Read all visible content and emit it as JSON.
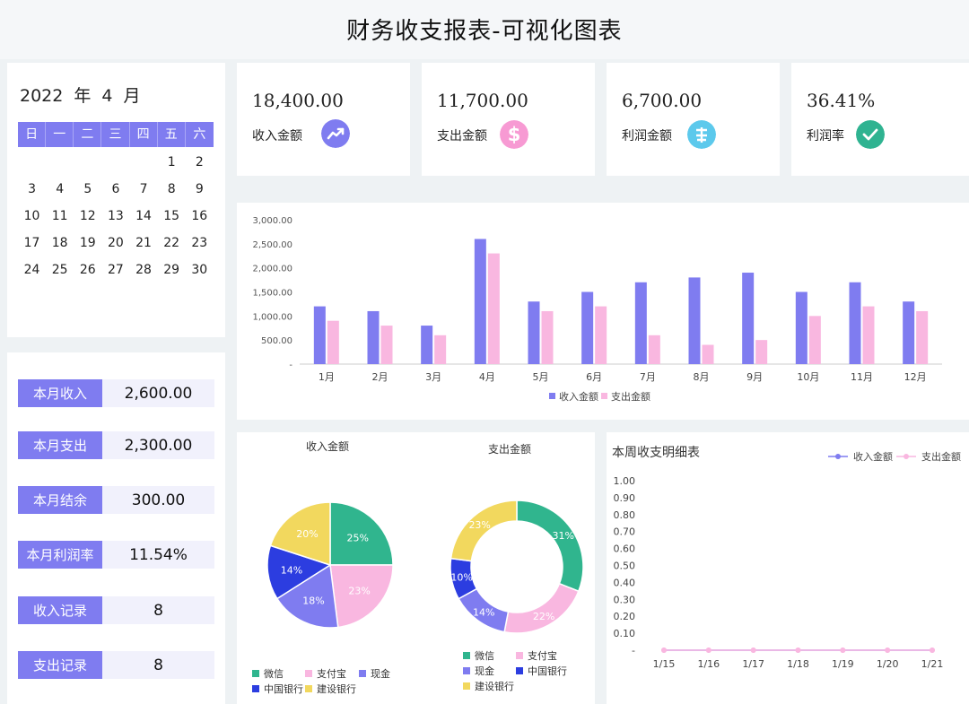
{
  "page_title": "财务收支报表-可视化图表",
  "calendar": {
    "year": "2022",
    "year_unit": "年",
    "month": "4",
    "month_unit": "月",
    "weekdays": [
      "日",
      "一",
      "二",
      "三",
      "四",
      "五",
      "六"
    ],
    "weeks": [
      [
        "",
        "",
        "",
        "",
        "",
        "1",
        "2"
      ],
      [
        "3",
        "4",
        "5",
        "6",
        "7",
        "8",
        "9"
      ],
      [
        "10",
        "11",
        "12",
        "13",
        "14",
        "15",
        "16"
      ],
      [
        "17",
        "18",
        "19",
        "20",
        "21",
        "22",
        "23"
      ],
      [
        "24",
        "25",
        "26",
        "27",
        "28",
        "29",
        "30"
      ]
    ]
  },
  "stats": [
    {
      "label": "本月收入",
      "value": "2,600.00"
    },
    {
      "label": "本月支出",
      "value": "2,300.00"
    },
    {
      "label": "本月结余",
      "value": "300.00"
    },
    {
      "label": "本月利润率",
      "value": "11.54%"
    },
    {
      "label": "收入记录",
      "value": "8"
    },
    {
      "label": "支出记录",
      "value": "8"
    }
  ],
  "kpis": [
    {
      "value": "18,400.00",
      "label": "收入金额",
      "icon": "trend-up-icon",
      "color": "#7f7cf0"
    },
    {
      "value": "11,700.00",
      "label": "支出金额",
      "icon": "dollar-icon",
      "color": "#f79ad3"
    },
    {
      "value": "6,700.00",
      "label": "利润金额",
      "icon": "currency-icon",
      "color": "#5cc9ec"
    },
    {
      "value": "36.41%",
      "label": "利润率",
      "icon": "check-icon",
      "color": "#2fb391"
    }
  ],
  "colors": {
    "income": "#7f7cf0",
    "expense": "#f9b7e0",
    "wechat": "#30b58e",
    "alipay": "#f9b7e0",
    "cash": "#7f7cf0",
    "boc": "#2c3de0",
    "ccb": "#f2d85e"
  },
  "chart_data": [
    {
      "type": "bar",
      "categories": [
        "1月",
        "2月",
        "3月",
        "4月",
        "5月",
        "6月",
        "7月",
        "8月",
        "9月",
        "10月",
        "11月",
        "12月"
      ],
      "series": [
        {
          "name": "收入金额",
          "values": [
            1200,
            1100,
            800,
            2600,
            1300,
            1500,
            1700,
            1800,
            1900,
            1500,
            1700,
            1300
          ]
        },
        {
          "name": "支出金额",
          "values": [
            900,
            800,
            600,
            2300,
            1100,
            1200,
            600,
            400,
            500,
            1000,
            1200,
            1100
          ]
        }
      ],
      "yticks": [
        "-",
        "500.00",
        "1,000.00",
        "1,500.00",
        "2,000.00",
        "2,500.00",
        "3,000.00"
      ],
      "ylim": [
        0,
        3000
      ],
      "legend": "bottom-center"
    },
    {
      "type": "pie",
      "title": "收入金额",
      "labels": [
        "微信",
        "支付宝",
        "现金",
        "中国银行",
        "建设银行"
      ],
      "values": [
        25,
        23,
        18,
        14,
        20
      ],
      "value_labels": [
        "25%",
        "23%",
        "18%",
        "14%",
        "20%"
      ],
      "legend": "bottom-left"
    },
    {
      "type": "pie",
      "title": "支出金额",
      "donut": true,
      "labels": [
        "微信",
        "支付宝",
        "现金",
        "中国银行",
        "建设银行"
      ],
      "values": [
        31,
        22,
        14,
        10,
        23
      ],
      "value_labels": [
        "31%",
        "22%",
        "14%",
        "10%",
        "23%"
      ],
      "legend": "bottom-left"
    },
    {
      "type": "line",
      "title": "本周收支明细表",
      "x": [
        "1/15",
        "1/16",
        "1/17",
        "1/18",
        "1/19",
        "1/20",
        "1/21"
      ],
      "series": [
        {
          "name": "收入金额",
          "values": [
            0,
            0,
            0,
            0,
            0,
            0,
            0
          ]
        },
        {
          "name": "支出金额",
          "values": [
            0,
            0,
            0,
            0,
            0,
            0,
            0
          ]
        }
      ],
      "yticks": [
        "-",
        "0.10",
        "0.20",
        "0.30",
        "0.40",
        "0.50",
        "0.60",
        "0.70",
        "0.80",
        "0.90",
        "1.00"
      ],
      "ylim": [
        0,
        1
      ],
      "legend": "top-right"
    }
  ]
}
